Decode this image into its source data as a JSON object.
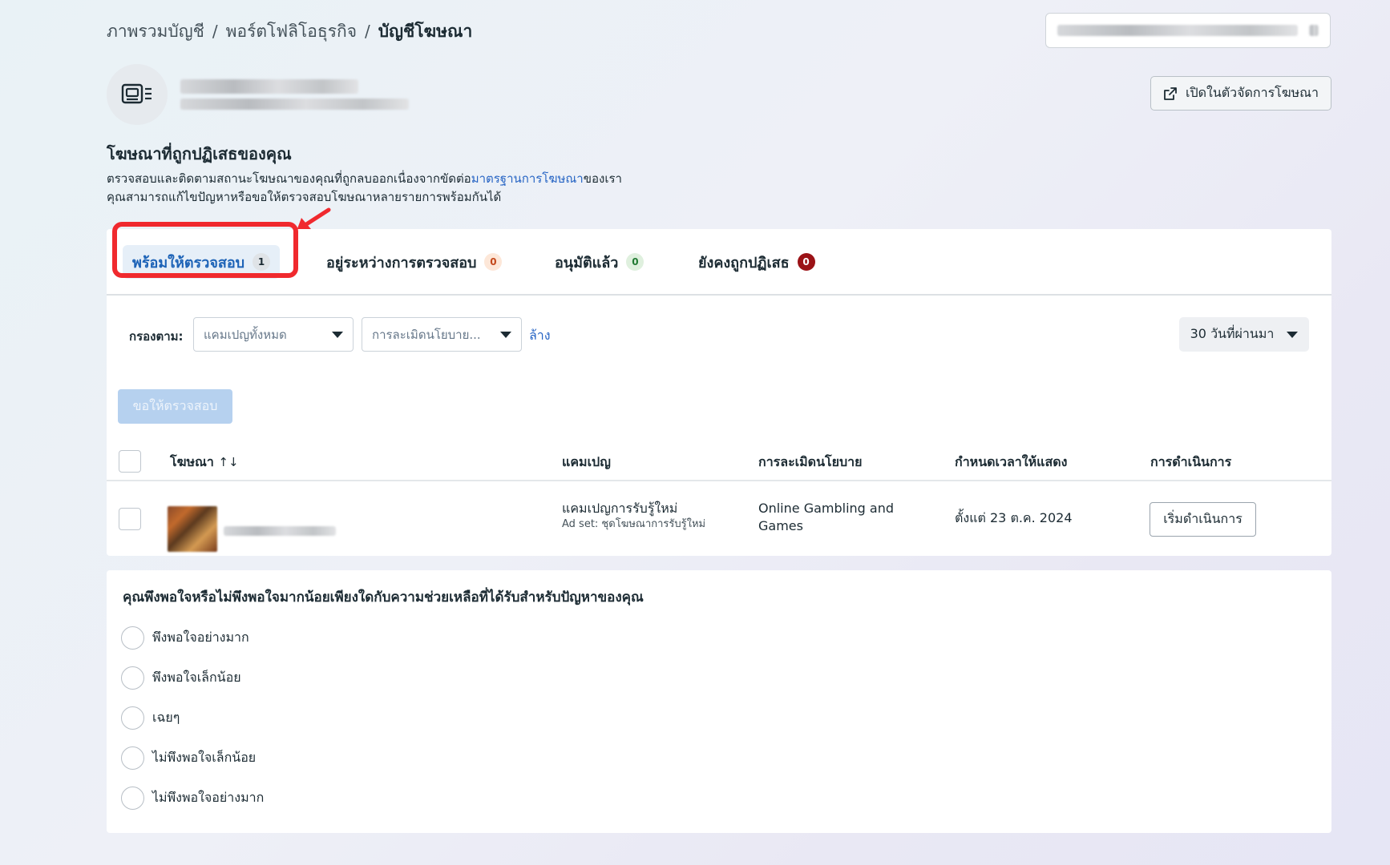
{
  "breadcrumb": {
    "items": [
      "ภาพรวมบัญชี",
      "พอร์ตโฟลิโอธุรกิจ",
      "บัญชีโฆษณา"
    ],
    "separator": "/"
  },
  "header": {
    "open_in_ads_manager": "เปิดในตัวจัดการโฆษณา"
  },
  "intro": {
    "title": "โฆษณาที่ถูกปฏิเสธของคุณ",
    "desc_line1_prefix": "ตรวจสอบและติดตามสถานะโฆษณาของคุณที่ถูกลบออกเนื่องจากขัดต่อ",
    "desc_line1_link": "มาตรฐานการโฆษณา",
    "desc_line1_suffix": "ของเรา",
    "desc_line2": "คุณสามารถแก้ไขปัญหาหรือขอให้ตรวจสอบโฆษณาหลายรายการพร้อมกันได้"
  },
  "tabs": [
    {
      "label": "พร้อมให้ตรวจสอบ",
      "count": "1"
    },
    {
      "label": "อยู่ระหว่างการตรวจสอบ",
      "count": "0"
    },
    {
      "label": "อนุมัติแล้ว",
      "count": "0"
    },
    {
      "label": "ยังคงถูกปฏิเสธ",
      "count": "0"
    }
  ],
  "filters": {
    "label": "กรองตาม:",
    "campaign_placeholder": "แคมเปญทั้งหมด",
    "policy_placeholder": "การละเมิดนโยบาย...",
    "clear": "ล้าง",
    "date_range": "30 วันที่ผ่านมา"
  },
  "request_review_button": "ขอให้ตรวจสอบ",
  "table": {
    "headers": {
      "ad": "โฆษณา",
      "sort_icon": "↑↓",
      "campaign": "แคมเปญ",
      "policy": "การละเมิดนโยบาย",
      "schedule": "กำหนดเวลาให้แสดง",
      "action": "การดำเนินการ"
    },
    "rows": [
      {
        "campaign": "แคมเปญการรับรู้ใหม่",
        "ad_set": "Ad set: ชุดโฆษณาการรับรู้ใหม่",
        "policy_line1": "Online Gambling and",
        "policy_line2": "Games",
        "schedule": "ตั้งแต่ 23 ต.ค. 2024",
        "action_label": "เริ่มดำเนินการ"
      }
    ]
  },
  "survey": {
    "question": "คุณพึงพอใจหรือไม่พึงพอใจมากน้อยเพียงใดกับความช่วยเหลือที่ได้รับสำหรับปัญหาของคุณ",
    "options": [
      "พึงพอใจอย่างมาก",
      "พึงพอใจเล็กน้อย",
      "เฉยๆ",
      "ไม่พึงพอใจเล็กน้อย",
      "ไม่พึงพอใจอย่างมาก"
    ]
  },
  "colors": {
    "accent_blue": "#1d63b7",
    "link_blue": "#2664c4",
    "highlight_red": "#f0292e"
  }
}
